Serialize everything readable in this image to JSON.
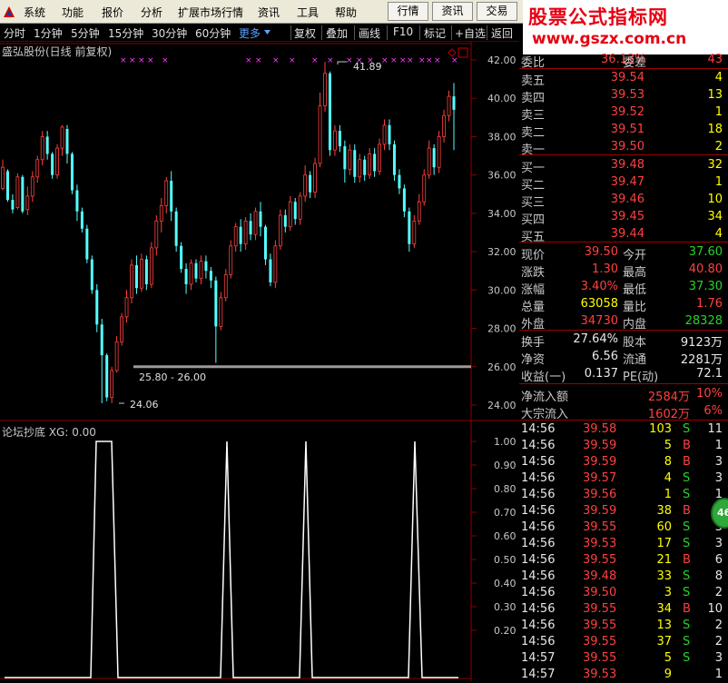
{
  "menu": {
    "items": [
      "系统",
      "功能",
      "报价",
      "分析",
      "扩展市场行情",
      "资讯",
      "工具",
      "帮助"
    ],
    "tabs": [
      "行情",
      "资讯",
      "交易"
    ]
  },
  "brand": {
    "title": "股票公式指标网",
    "url": "www.gszx.com.cn"
  },
  "toolbar": {
    "periods": [
      "分时",
      "1分钟",
      "5分钟",
      "15分钟",
      "30分钟",
      "60分钟"
    ],
    "more": "更多",
    "buttons": [
      "复权",
      "叠加",
      "画线",
      "F10",
      "标记",
      "+自选",
      "返回"
    ]
  },
  "chart": {
    "title": "盛弘股份(日线 前复权)",
    "high_label": "41.89",
    "low_label": "24.06",
    "range_label": "25.80 - 26.00",
    "y_ticks": [
      "42.00",
      "40.00",
      "38.00",
      "36.00",
      "34.00",
      "32.00",
      "30.00",
      "28.00",
      "26.00",
      "24.00"
    ]
  },
  "indicator": {
    "title": "论坛抄底 XG: 0.00",
    "y_ticks": [
      "1.00",
      "0.90",
      "0.80",
      "0.70",
      "0.60",
      "0.50",
      "0.40",
      "0.30",
      "0.20"
    ]
  },
  "quote": {
    "ratio": {
      "label": "委比",
      "value": "36.13%",
      "label2": "委差",
      "value2": "43"
    },
    "asks": [
      {
        "label": "卖五",
        "price": "39.54",
        "vol": "4"
      },
      {
        "label": "卖四",
        "price": "39.53",
        "vol": "13"
      },
      {
        "label": "卖三",
        "price": "39.52",
        "vol": "1"
      },
      {
        "label": "卖二",
        "price": "39.51",
        "vol": "18"
      },
      {
        "label": "卖一",
        "price": "39.50",
        "vol": "2"
      }
    ],
    "bids": [
      {
        "label": "买一",
        "price": "39.48",
        "vol": "32"
      },
      {
        "label": "买二",
        "price": "39.47",
        "vol": "1"
      },
      {
        "label": "买三",
        "price": "39.46",
        "vol": "10"
      },
      {
        "label": "买四",
        "price": "39.45",
        "vol": "34"
      },
      {
        "label": "买五",
        "price": "39.44",
        "vol": "4"
      }
    ],
    "stats": [
      {
        "l1": "现价",
        "v1": "39.50",
        "c1": "red",
        "l2": "今开",
        "v2": "37.60",
        "c2": "grn"
      },
      {
        "l1": "涨跌",
        "v1": "1.30",
        "c1": "red",
        "l2": "最高",
        "v2": "40.80",
        "c2": "red"
      },
      {
        "l1": "涨幅",
        "v1": "3.40%",
        "c1": "red",
        "l2": "最低",
        "v2": "37.30",
        "c2": "grn"
      },
      {
        "l1": "总量",
        "v1": "63058",
        "c1": "yel",
        "l2": "量比",
        "v2": "1.76",
        "c2": "red"
      },
      {
        "l1": "外盘",
        "v1": "34730",
        "c1": "red",
        "l2": "内盘",
        "v2": "28328",
        "c2": "grn"
      }
    ],
    "fin": [
      {
        "l1": "换手",
        "v1": "27.64%",
        "l2": "股本",
        "v2": "9123万"
      },
      {
        "l1": "净资",
        "v1": "6.56",
        "l2": "流通",
        "v2": "2281万"
      },
      {
        "l1": "收益(一)",
        "v1": "0.137",
        "l2": "PE(动)",
        "v2": "72.1"
      }
    ],
    "flow": [
      {
        "label": "净流入额",
        "value": "2584万",
        "pct": "10%"
      },
      {
        "label": "大宗流入",
        "value": "1602万",
        "pct": "6%"
      }
    ],
    "ticks": [
      {
        "t": "14:56",
        "p": "39.58",
        "v": "103",
        "s": "S",
        "n": "11"
      },
      {
        "t": "14:56",
        "p": "39.59",
        "v": "5",
        "s": "B",
        "n": "1"
      },
      {
        "t": "14:56",
        "p": "39.59",
        "v": "8",
        "s": "B",
        "n": "3"
      },
      {
        "t": "14:56",
        "p": "39.57",
        "v": "4",
        "s": "S",
        "n": "3"
      },
      {
        "t": "14:56",
        "p": "39.56",
        "v": "1",
        "s": "S",
        "n": "1"
      },
      {
        "t": "14:56",
        "p": "39.59",
        "v": "38",
        "s": "B",
        "n": "3"
      },
      {
        "t": "14:56",
        "p": "39.55",
        "v": "60",
        "s": "S",
        "n": "3"
      },
      {
        "t": "14:56",
        "p": "39.53",
        "v": "17",
        "s": "S",
        "n": "3"
      },
      {
        "t": "14:56",
        "p": "39.55",
        "v": "21",
        "s": "B",
        "n": "6"
      },
      {
        "t": "14:56",
        "p": "39.48",
        "v": "33",
        "s": "S",
        "n": "8"
      },
      {
        "t": "14:56",
        "p": "39.50",
        "v": "3",
        "s": "S",
        "n": "2"
      },
      {
        "t": "14:56",
        "p": "39.55",
        "v": "34",
        "s": "B",
        "n": "10"
      },
      {
        "t": "14:56",
        "p": "39.55",
        "v": "13",
        "s": "S",
        "n": "2"
      },
      {
        "t": "14:56",
        "p": "39.55",
        "v": "37",
        "s": "S",
        "n": "2"
      },
      {
        "t": "14:57",
        "p": "39.55",
        "v": "5",
        "s": "S",
        "n": "3"
      },
      {
        "t": "14:57",
        "p": "39.53",
        "v": "9",
        "s": "",
        "n": "1"
      }
    ]
  },
  "bubble": {
    "label": "46"
  },
  "colors": {
    "up": "#ff4040",
    "down": "#54ffff",
    "grid": "#8b0000",
    "signal": "#ffffff",
    "marker": "#ff3cff"
  }
}
